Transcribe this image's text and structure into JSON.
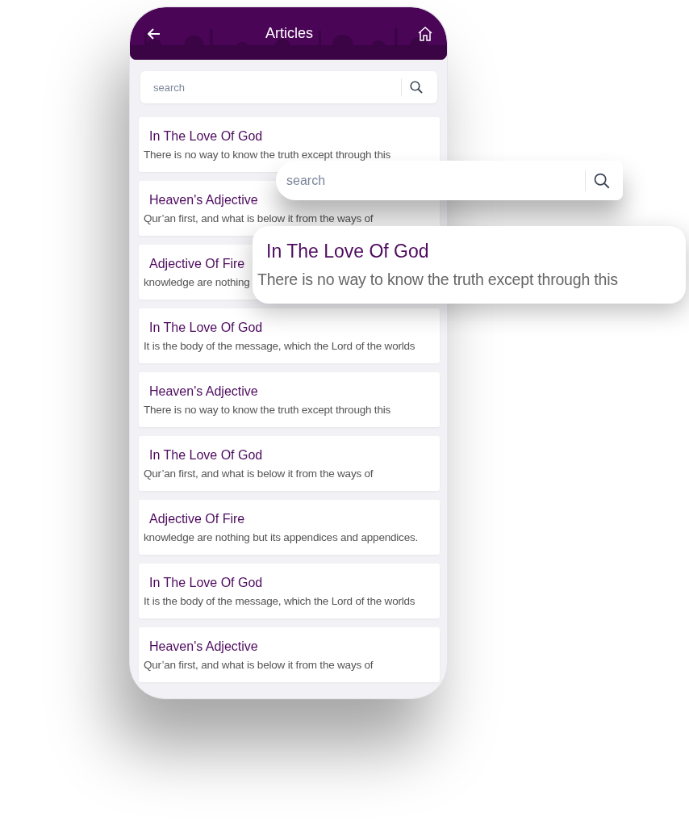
{
  "header": {
    "title": "Articles"
  },
  "search": {
    "placeholder": "search"
  },
  "articles": [
    {
      "title": "In The Love Of God",
      "subtitle": "There is no way to know the truth except through this"
    },
    {
      "title": "Heaven's Adjective",
      "subtitle": "Qur’an first, and what is below it from the ways of"
    },
    {
      "title": "Adjective Of Fire",
      "subtitle": "knowledge are nothing"
    },
    {
      "title": "In The Love Of God",
      "subtitle": "It is the body of the message, which the Lord of the worlds"
    },
    {
      "title": "Heaven's Adjective",
      "subtitle": "There is no way to know the truth except through this"
    },
    {
      "title": "In The Love Of God",
      "subtitle": "Qur’an first, and what is below it from the ways of"
    },
    {
      "title": "Adjective Of Fire",
      "subtitle": "knowledge are nothing but its appendices and appendices."
    },
    {
      "title": "In The Love Of God",
      "subtitle": "It is the body of the message, which the Lord of the worlds"
    },
    {
      "title": "Heaven's Adjective",
      "subtitle": "Qur’an first, and what is below it from the ways of"
    }
  ],
  "overlay_search": {
    "placeholder": "search"
  },
  "overlay_card": {
    "title": "In The Love Of God",
    "subtitle": "There is no way to know the truth except through this"
  }
}
